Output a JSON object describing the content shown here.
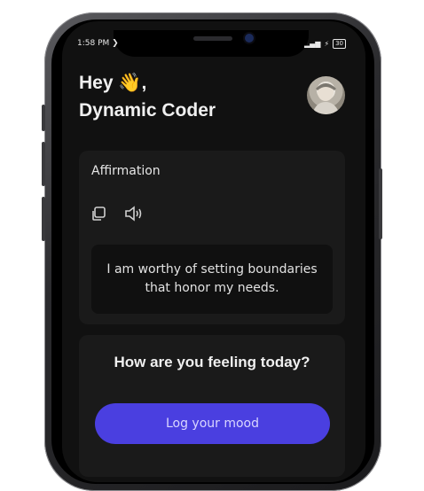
{
  "status_bar": {
    "time": "1:58 PM",
    "battery": "30"
  },
  "header": {
    "line1": "Hey 👋,",
    "line2": "Dynamic Coder"
  },
  "affirmation": {
    "title": "Affirmation",
    "text": "I am worthy of setting boundaries that honor my needs."
  },
  "mood": {
    "question": "How are you feeling today?",
    "button_label": "Log your mood"
  },
  "colors": {
    "background": "#111111",
    "card": "#1a1a1a",
    "accent": "#4a3fe0"
  }
}
